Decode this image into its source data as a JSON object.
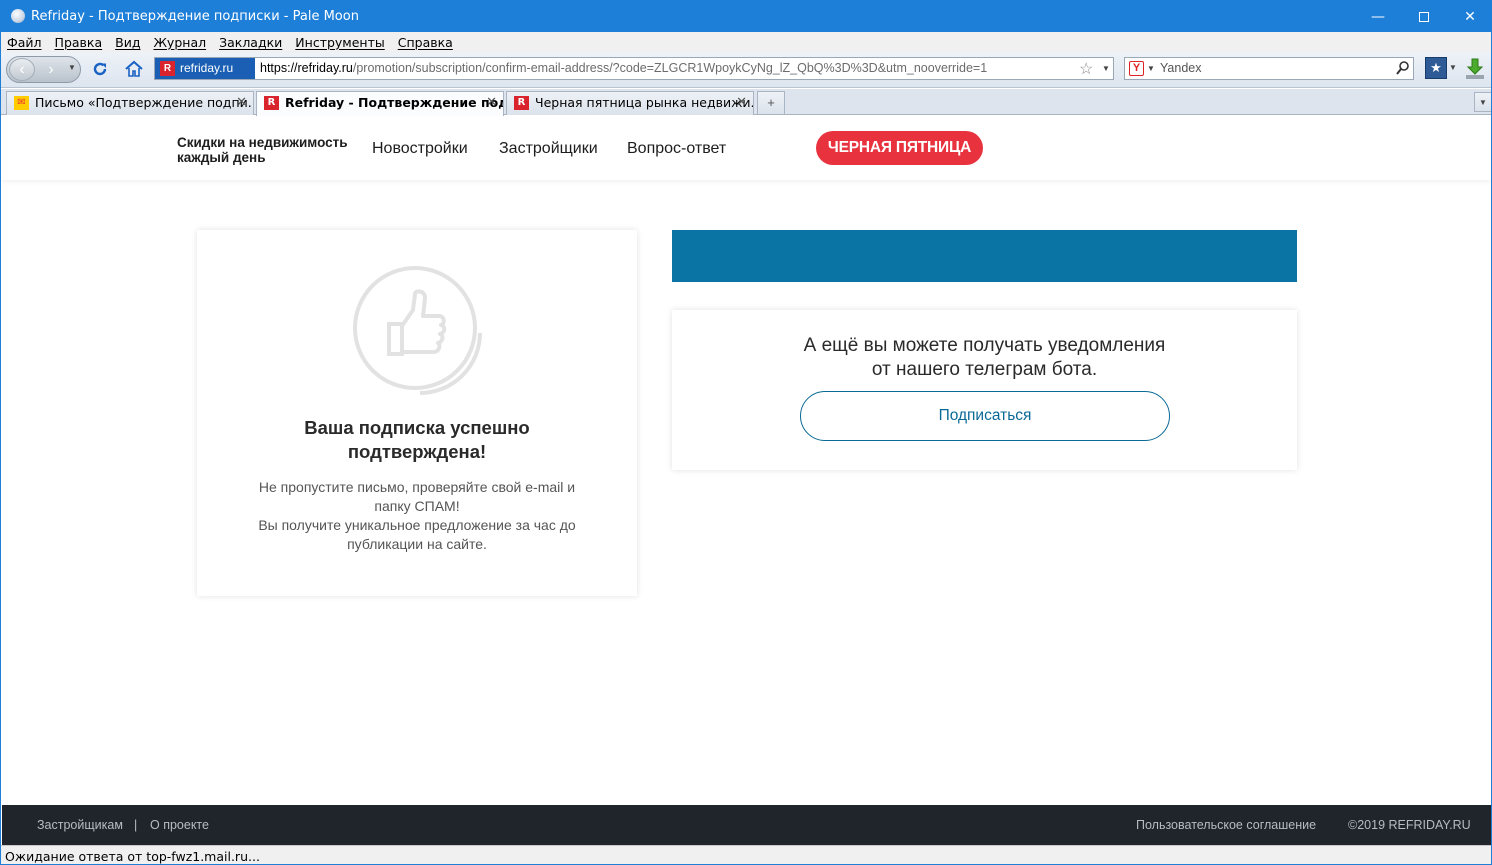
{
  "window": {
    "title": "Refriday - Подтверждение подписки - Pale Moon",
    "minimize": "—",
    "close": "✕"
  },
  "menu": [
    "Файл",
    "Правка",
    "Вид",
    "Журнал",
    "Закладки",
    "Инструменты",
    "Справка"
  ],
  "navbar": {
    "site_badge": "refriday.ru",
    "url_host": "https://refriday.ru",
    "url_path": "/promotion/subscription/confirm-email-address/?code=ZLGCR1WpoykCyNg_lZ_QbQ%3D%3D&utm_nooverride=1",
    "search_engine": "Yandex"
  },
  "tabs": [
    {
      "label": "Письмо «Подтверждение подпи...",
      "icon": "mail-icon",
      "active": false
    },
    {
      "label": "Refriday - Подтверждение подп...",
      "icon": "refriday-favicon",
      "active": true
    },
    {
      "label": "Черная пятница рынка недвижи...",
      "icon": "refriday-favicon",
      "active": false
    }
  ],
  "site": {
    "logo_line1": "Скидки на недвижимость",
    "logo_line2": "каждый день",
    "nav": [
      "Новостройки",
      "Застройщики",
      "Вопрос-ответ"
    ],
    "black_friday_button": "ЧЕРНАЯ ПЯТНИЦА"
  },
  "confirmation": {
    "title_line1": "Ваша подписка успешно",
    "title_line2": "подтверждена!",
    "text_line1": "Не пропустите письмо, проверяйте свой e-mail и",
    "text_line2": "папку СПАМ!",
    "text_line3": "Вы получите уникальное предложение за час до",
    "text_line4": "публикации на сайте."
  },
  "telegram": {
    "text_line1": "А ещё вы можете получать уведомления",
    "text_line2": "от нашего телеграм бота.",
    "button": "Подписаться"
  },
  "footer": {
    "link1": "Застройщикам",
    "separator": "|",
    "link2": "О проекте",
    "agreement": "Пользовательское соглашение",
    "copyright": "©2019 REFRIDAY.RU"
  },
  "status": "Ожидание ответа от top-fwz1.mail.ru...",
  "colors": {
    "titlebar": "#1e7fd8",
    "brand_red": "#e8333f",
    "blue_bar": "#0a74a5",
    "footer_bg": "#1f252b"
  }
}
